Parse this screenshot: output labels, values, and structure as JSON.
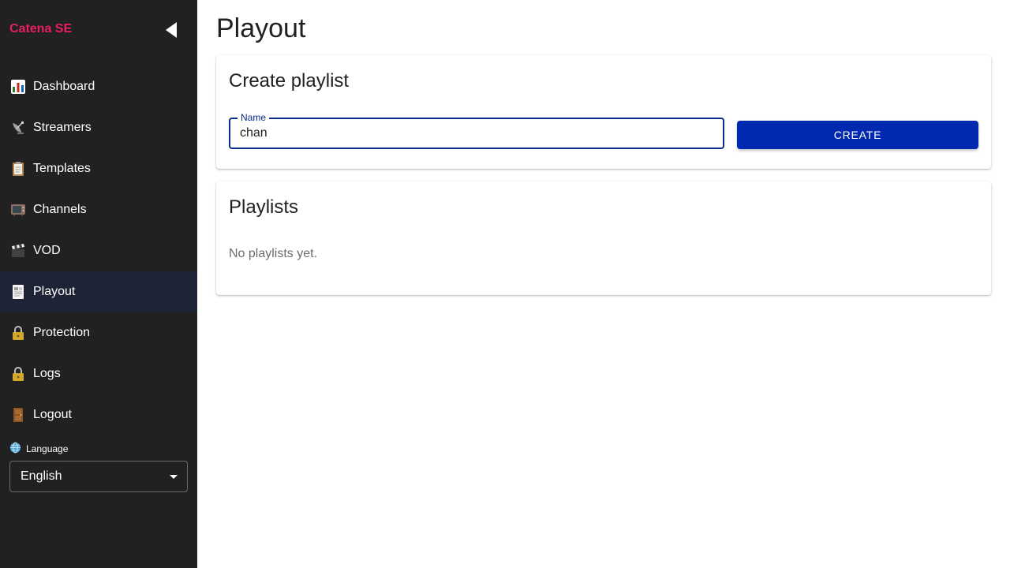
{
  "sidebar": {
    "brand": "Catena SE",
    "items": [
      {
        "label": "Dashboard",
        "icon": "bar-chart-icon"
      },
      {
        "label": "Streamers",
        "icon": "satellite-dish-icon"
      },
      {
        "label": "Templates",
        "icon": "clipboard-icon"
      },
      {
        "label": "Channels",
        "icon": "television-icon"
      },
      {
        "label": "VOD",
        "icon": "clapperboard-icon"
      },
      {
        "label": "Playout",
        "icon": "document-icon",
        "active": true
      },
      {
        "label": "Protection",
        "icon": "lock-icon"
      },
      {
        "label": "Logs",
        "icon": "lock-icon"
      },
      {
        "label": "Logout",
        "icon": "door-icon"
      }
    ],
    "language_label": "Language",
    "language_value": "English"
  },
  "page": {
    "title": "Playout"
  },
  "create_card": {
    "title": "Create playlist",
    "name_label": "Name",
    "name_value": "chan",
    "button_label": "CREATE"
  },
  "playlists_card": {
    "title": "Playlists",
    "empty_text": "No playlists yet."
  },
  "colors": {
    "brand": "#e91e63",
    "sidebar_bg": "#212121",
    "active_item_bg": "#1e2335",
    "primary": "#0029b0"
  }
}
